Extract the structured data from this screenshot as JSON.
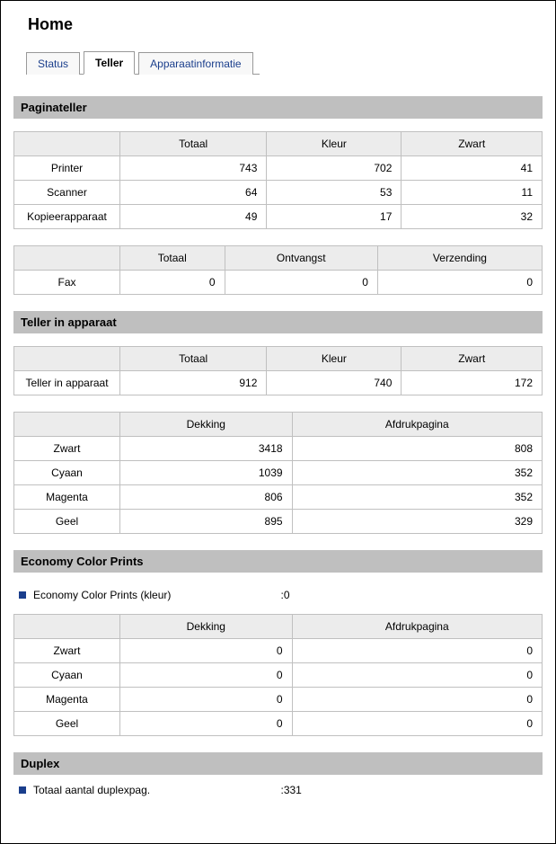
{
  "title": "Home",
  "tabs": {
    "status": "Status",
    "teller": "Teller",
    "apparaat": "Apparaatinformatie"
  },
  "sections": {
    "paginateller": {
      "title": "Paginateller",
      "cols": {
        "totaal": "Totaal",
        "kleur": "Kleur",
        "zwart": "Zwart"
      },
      "rows": [
        {
          "label": "Printer",
          "totaal": 743,
          "kleur": 702,
          "zwart": 41
        },
        {
          "label": "Scanner",
          "totaal": 64,
          "kleur": 53,
          "zwart": 11
        },
        {
          "label": "Kopieerapparaat",
          "totaal": 49,
          "kleur": 17,
          "zwart": 32
        }
      ],
      "fax_cols": {
        "totaal": "Totaal",
        "ontvangst": "Ontvangst",
        "verzending": "Verzending"
      },
      "fax": {
        "label": "Fax",
        "totaal": 0,
        "ontvangst": 0,
        "verzending": 0
      }
    },
    "teller_in_apparaat": {
      "title": "Teller in apparaat",
      "cols": {
        "totaal": "Totaal",
        "kleur": "Kleur",
        "zwart": "Zwart"
      },
      "row": {
        "label": "Teller in apparaat",
        "totaal": 912,
        "kleur": 740,
        "zwart": 172
      },
      "cov_cols": {
        "dekking": "Dekking",
        "afdruk": "Afdrukpagina"
      },
      "cov_rows": [
        {
          "label": "Zwart",
          "dekking": 3418,
          "afdruk": 808
        },
        {
          "label": "Cyaan",
          "dekking": 1039,
          "afdruk": 352
        },
        {
          "label": "Magenta",
          "dekking": 806,
          "afdruk": 352
        },
        {
          "label": "Geel",
          "dekking": 895,
          "afdruk": 329
        }
      ]
    },
    "economy": {
      "title": "Economy Color Prints",
      "kv": {
        "label": "Economy Color Prints (kleur)",
        "value": ":0"
      },
      "cov_cols": {
        "dekking": "Dekking",
        "afdruk": "Afdrukpagina"
      },
      "cov_rows": [
        {
          "label": "Zwart",
          "dekking": 0,
          "afdruk": 0
        },
        {
          "label": "Cyaan",
          "dekking": 0,
          "afdruk": 0
        },
        {
          "label": "Magenta",
          "dekking": 0,
          "afdruk": 0
        },
        {
          "label": "Geel",
          "dekking": 0,
          "afdruk": 0
        }
      ]
    },
    "duplex": {
      "title": "Duplex",
      "kv": {
        "label": "Totaal aantal duplexpag.",
        "value": ":331"
      }
    }
  }
}
